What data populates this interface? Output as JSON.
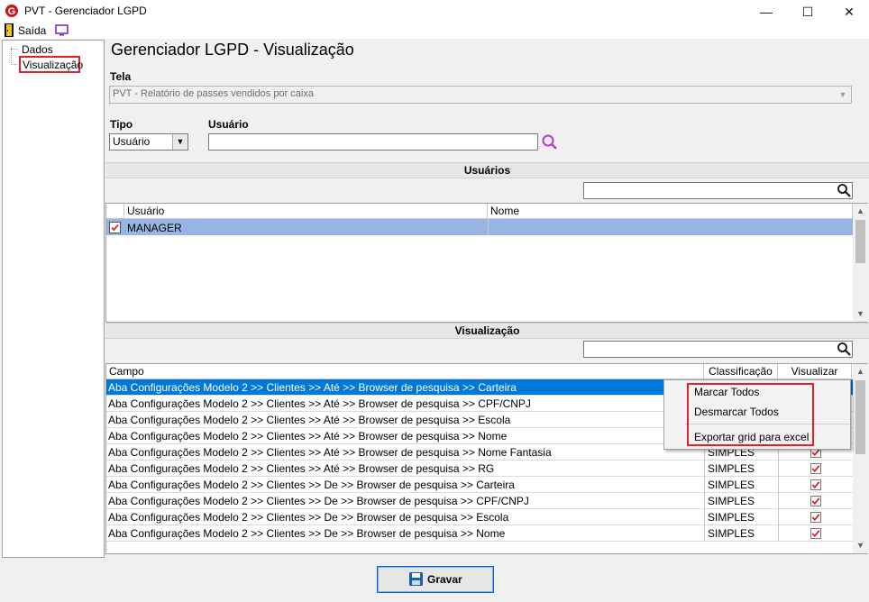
{
  "window": {
    "title": "PVT - Gerenciador LGPD"
  },
  "menubar": {
    "exit_label": "Saída"
  },
  "tree": {
    "items": [
      "Dados",
      "Visualização"
    ]
  },
  "main": {
    "title": "Gerenciador LGPD - Visualização",
    "tela_label": "Tela",
    "tela_value": "PVT - Relatório de passes vendidos por caixa",
    "tipo_label": "Tipo",
    "tipo_value": "Usuário",
    "usuario_label": "Usuário",
    "usuario_value": ""
  },
  "users_section": {
    "title": "Usuários",
    "columns": [
      "Usuário",
      "Nome"
    ],
    "rows": [
      {
        "usuario": "MANAGER",
        "nome": "",
        "checked": true
      }
    ]
  },
  "vis_section": {
    "title": "Visualização",
    "columns": [
      "Campo",
      "Classificação",
      "Visualizar"
    ],
    "rows": [
      {
        "campo": "Aba Configurações Modelo 2 >> Clientes >> Até >> Browser de pesquisa >> Carteira",
        "classificacao": "",
        "checked": false
      },
      {
        "campo": "Aba Configurações Modelo 2 >> Clientes >> Até >> Browser de pesquisa >> CPF/CNPJ",
        "classificacao": "",
        "checked": false
      },
      {
        "campo": "Aba Configurações Modelo 2 >> Clientes >> Até >> Browser de pesquisa >> Escola",
        "classificacao": "",
        "checked": false
      },
      {
        "campo": "Aba Configurações Modelo 2 >> Clientes >> Até >> Browser de pesquisa >> Nome",
        "classificacao": "",
        "checked": false
      },
      {
        "campo": "Aba Configurações Modelo 2 >> Clientes >> Até >> Browser de pesquisa >> Nome Fantasia",
        "classificacao": "SIMPLES",
        "checked": true
      },
      {
        "campo": "Aba Configurações Modelo 2 >> Clientes >> Até >> Browser de pesquisa >> RG",
        "classificacao": "SIMPLES",
        "checked": true
      },
      {
        "campo": "Aba Configurações Modelo 2 >> Clientes >> De >> Browser de pesquisa >> Carteira",
        "classificacao": "SIMPLES",
        "checked": true
      },
      {
        "campo": "Aba Configurações Modelo 2 >> Clientes >> De >> Browser de pesquisa >> CPF/CNPJ",
        "classificacao": "SIMPLES",
        "checked": true
      },
      {
        "campo": "Aba Configurações Modelo 2 >> Clientes >> De >> Browser de pesquisa >> Escola",
        "classificacao": "SIMPLES",
        "checked": true
      },
      {
        "campo": "Aba Configurações Modelo 2 >> Clientes >> De >> Browser de pesquisa >> Nome",
        "classificacao": "SIMPLES",
        "checked": true
      }
    ]
  },
  "context_menu": {
    "items": [
      "Marcar Todos",
      "Desmarcar Todos",
      "Exportar grid para excel"
    ]
  },
  "footer": {
    "save_label": "Gravar"
  },
  "colors": {
    "selection": "#0078d7",
    "user_row": "#98b4e4",
    "highlight_box": "#e0202a",
    "check": "#d0202a"
  }
}
